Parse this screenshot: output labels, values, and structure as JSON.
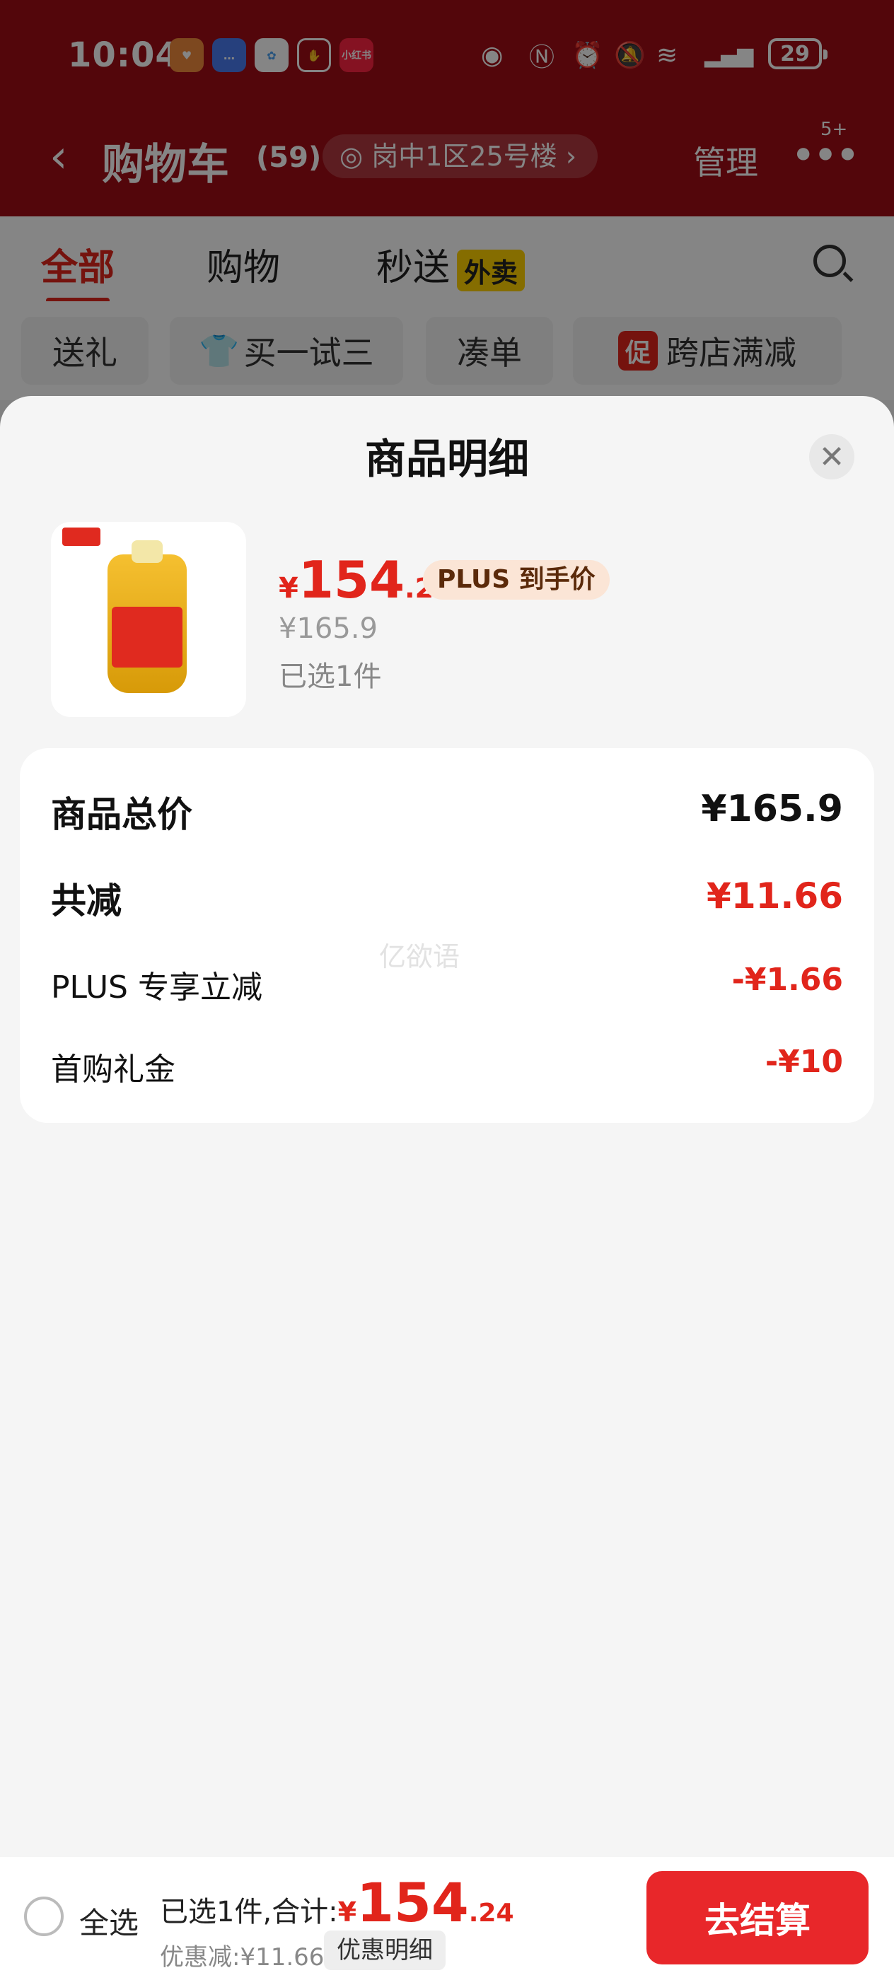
{
  "status_bar": {
    "time": "10:04",
    "battery": "29",
    "app_icons": [
      "taobao-icon",
      "message-icon",
      "pinwheel-icon",
      "hand-icon",
      "xiaohongshu-icon"
    ],
    "xiaohongshu_text": "小红书"
  },
  "header": {
    "title": "购物车",
    "count": "(59)",
    "address": "岗中1区25号楼",
    "manage": "管理",
    "more_badge": "5+"
  },
  "tabs": [
    {
      "label": "全部"
    },
    {
      "label": "购物"
    },
    {
      "label": "秒送"
    }
  ],
  "tab_tag": "外卖",
  "filter_chips": [
    {
      "label": "送礼"
    },
    {
      "label": "买一试三"
    },
    {
      "label": "凑单"
    },
    {
      "label": "跨店满减"
    }
  ],
  "promo_tag": "促",
  "sheet": {
    "title": "商品明细",
    "product": {
      "price_symbol": "¥",
      "price_int": "154",
      "price_dec": ".24",
      "plus_tag": "PLUS 到手价",
      "original_price": "¥165.9",
      "selected": "已选1件"
    },
    "summary": {
      "total_label": "商品总价",
      "total_value": "¥165.9",
      "reduce_label": "共减",
      "reduce_value": "¥11.66",
      "items": [
        {
          "label": "PLUS 专享立减",
          "value": "-¥1.66"
        },
        {
          "label": "首购礼金",
          "value": "-¥10"
        }
      ]
    },
    "watermark": "亿欲语"
  },
  "bottom_bar": {
    "select_all": "全选",
    "total_prefix": "已选1件,合计:",
    "price_symbol": "¥",
    "price_int": "154",
    "price_dec": ".24",
    "discount": "优惠减:¥11.66",
    "detail_button": "优惠明细",
    "checkout": "去结算"
  },
  "colors": {
    "header_red": "#a00d16",
    "accent_red": "#e1251b",
    "checkout_red": "#e8272a"
  }
}
